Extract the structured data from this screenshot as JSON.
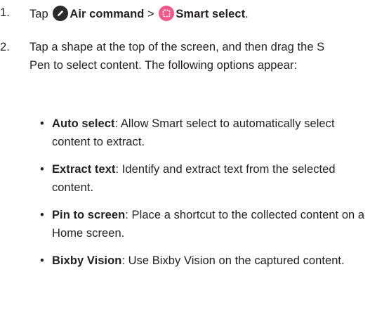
{
  "steps": [
    {
      "number": "1.",
      "parts": {
        "tap": "Tap",
        "air_icon": "pen-circle-icon",
        "air_label": "Air command",
        "separator": ">",
        "smart_icon": "smart-select-icon",
        "smart_label": "Smart select",
        "end": "."
      }
    },
    {
      "number": "2.",
      "text": "Tap a shape at the top of the screen, and then drag the S Pen to select content. The following options appear:"
    }
  ],
  "options": [
    {
      "bullet": "•",
      "title": "Auto select",
      "description": ": Allow Smart select to automatically select content to extract."
    },
    {
      "bullet": "•",
      "title": "Extract text",
      "description": ": Identify and extract text from the selected content."
    },
    {
      "bullet": "•",
      "title": "Pin to screen",
      "description": ": Place a shortcut to the collected content on a Home screen."
    },
    {
      "bullet": "•",
      "title": "Bixby Vision",
      "description": ": Use Bixby Vision on the captured content."
    }
  ],
  "colors": {
    "text": "#231f20",
    "air_icon_bg": "#2a2a2a",
    "smart_icon_bg": "#f05a8a"
  }
}
